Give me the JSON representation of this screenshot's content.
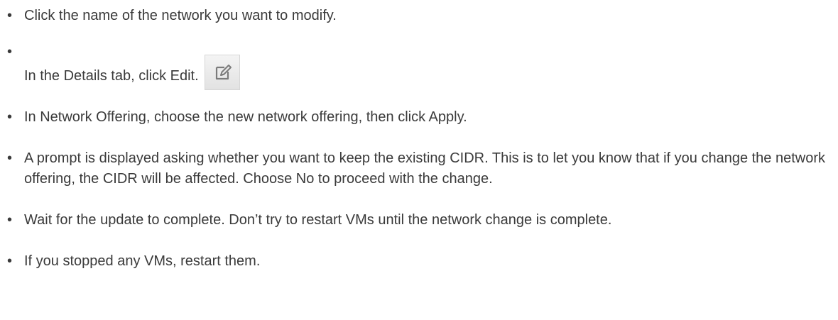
{
  "steps": [
    {
      "text": "Click the name of the network you want to modify."
    },
    {
      "text": "In the Details tab, click Edit.",
      "icon": "edit-icon"
    },
    {
      "text": "In Network Offering, choose the new network offering, then click Apply."
    },
    {
      "text": "A prompt is displayed asking whether you want to keep the existing CIDR. This is to let you know that if you change the network offering, the CIDR will be affected. Choose No to proceed with the change."
    },
    {
      "text": "Wait for the update to complete. Don’t try to restart VMs until the network change is complete."
    },
    {
      "text": "If you stopped any VMs, restart them."
    }
  ],
  "bullet_char": "•"
}
